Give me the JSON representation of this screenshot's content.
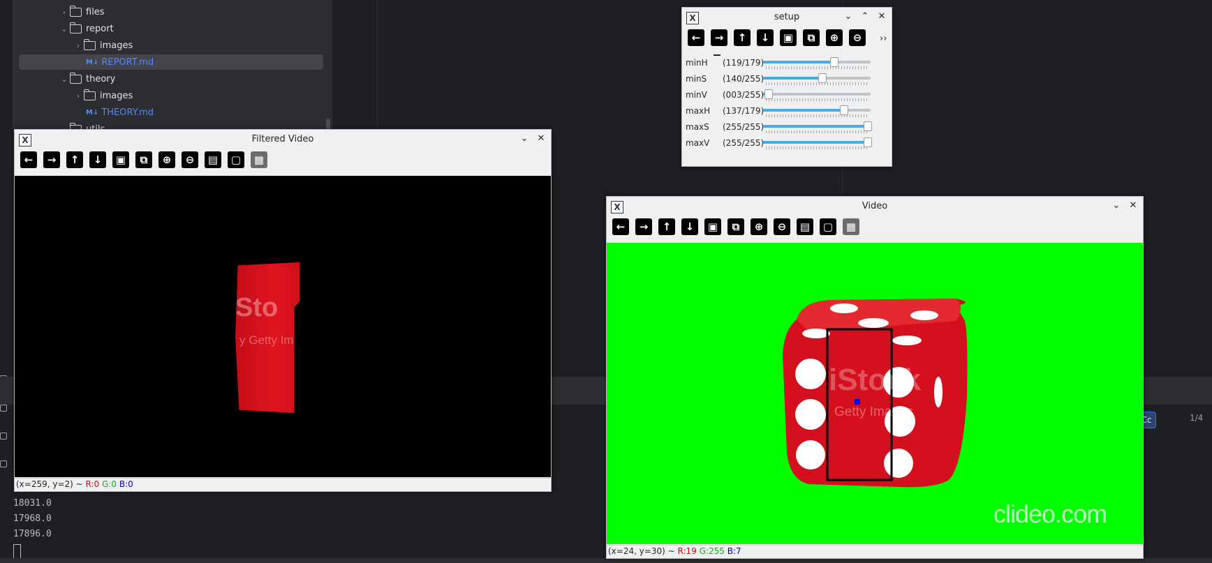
{
  "ide": {
    "tree": [
      {
        "label": "files",
        "type": "folder",
        "expanded": false,
        "depth": 1
      },
      {
        "label": "report",
        "type": "folder",
        "expanded": true,
        "depth": 1
      },
      {
        "label": "images",
        "type": "folder",
        "expanded": false,
        "depth": 2
      },
      {
        "label": "REPORT.md",
        "type": "md",
        "depth": 2,
        "selected": true
      },
      {
        "label": "theory",
        "type": "folder",
        "expanded": true,
        "depth": 1
      },
      {
        "label": "images",
        "type": "folder",
        "expanded": false,
        "depth": 2
      },
      {
        "label": "THEORY.md",
        "type": "md",
        "depth": 2
      },
      {
        "label": "utils",
        "type": "folder",
        "expanded": false,
        "depth": 1
      }
    ],
    "md_badge": "M↓",
    "find_regex_btn": "Cc",
    "find_count": "1/4",
    "console_lines": [
      "18031.0",
      "17968.0",
      "17896.0"
    ]
  },
  "filtered_window": {
    "title": "Filtered Video",
    "status": {
      "coords": "(x=259, y=2) ~",
      "r": "R:0",
      "g": "G:0",
      "b": "B:0"
    },
    "overlay_text_1": "Sto",
    "overlay_text_2": "y Getty Im"
  },
  "video_window": {
    "title": "Video",
    "status": {
      "coords": "(x=24, y=30) ~",
      "r": "R:19",
      "g": "G:255",
      "b": "B:7"
    },
    "watermark": "clideo.com",
    "istock": "iStock",
    "getty": "Getty Images"
  },
  "setup_window": {
    "title": "setup",
    "more": "››",
    "sliders": [
      {
        "label": "minH",
        "value": "(119/179)",
        "fraction": 0.665
      },
      {
        "label": "minS",
        "value": "(140/255)",
        "fraction": 0.549
      },
      {
        "label": "minV",
        "value": "(003/255)",
        "fraction": 0.012
      },
      {
        "label": "maxH",
        "value": "(137/179)",
        "fraction": 0.765
      },
      {
        "label": "maxS",
        "value": "(255/255)",
        "fraction": 1.0
      },
      {
        "label": "maxV",
        "value": "(255/255)",
        "fraction": 1.0
      }
    ]
  },
  "toolbar_icons": [
    "arrow-left-icon",
    "arrow-right-icon",
    "arrow-up-icon",
    "arrow-down-icon",
    "image-icon",
    "image-zoom-icon",
    "zoom-in-icon",
    "zoom-out-icon",
    "save-icon",
    "clipboard-icon",
    "properties-icon"
  ],
  "colors": {
    "green_screen": "#00ff00",
    "die_red": "#d4101e",
    "filtered_bg": "#000000"
  }
}
